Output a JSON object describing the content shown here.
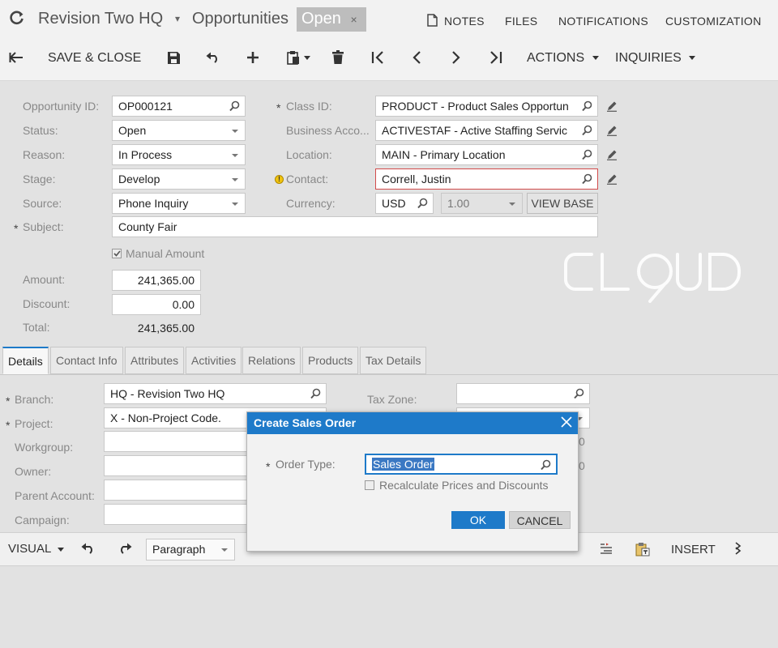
{
  "header": {
    "company": "Revision Two HQ",
    "separator_arrow": "▾",
    "screen": "Opportunities",
    "status": "Open",
    "status_close": "×",
    "links": [
      "NOTES",
      "FILES",
      "NOTIFICATIONS",
      "CUSTOMIZATION"
    ]
  },
  "toolbar": {
    "save_close": "SAVE & CLOSE",
    "actions": "ACTIONS",
    "inquiries": "INQUIRIES"
  },
  "form": {
    "opportunity_id": {
      "label": "Opportunity ID:",
      "value": "OP000121"
    },
    "status": {
      "label": "Status:",
      "value": "Open"
    },
    "reason": {
      "label": "Reason:",
      "value": "In Process"
    },
    "stage": {
      "label": "Stage:",
      "value": "Develop"
    },
    "source": {
      "label": "Source:",
      "value": "Phone Inquiry"
    },
    "subject": {
      "label": "Subject:",
      "value": "County Fair"
    },
    "manual_amount": {
      "label": "Manual Amount",
      "checked": true
    },
    "amount": {
      "label": "Amount:",
      "value": "241,365.00"
    },
    "discount": {
      "label": "Discount:",
      "value": "0.00"
    },
    "total": {
      "label": "Total:",
      "value": "241,365.00"
    },
    "class_id": {
      "label": "Class ID:",
      "value": "PRODUCT - Product Sales Opportun"
    },
    "business_account": {
      "label": "Business Acco...",
      "value": "ACTIVESTAF - Active Staffing Servic"
    },
    "location": {
      "label": "Location:",
      "value": "MAIN - Primary Location"
    },
    "contact": {
      "label": "Contact:",
      "value": "Correll, Justin"
    },
    "currency": {
      "label": "Currency:",
      "value": "USD",
      "rate": "1.00",
      "view_base": "VIEW BASE"
    },
    "required_mark": "*",
    "warning_mark": "!"
  },
  "watermark": "CLOUD",
  "tabs": [
    "Details",
    "Contact Info",
    "Attributes",
    "Activities",
    "Relations",
    "Products",
    "Tax Details"
  ],
  "details": {
    "branch": {
      "label": "Branch:",
      "value": "HQ - Revision Two HQ"
    },
    "project": {
      "label": "Project:",
      "value": "X - Non-Project Code."
    },
    "workgroup": {
      "label": "Workgroup:",
      "value": ""
    },
    "owner": {
      "label": "Owner:",
      "value": ""
    },
    "parent_account": {
      "label": "Parent Account:",
      "value": ""
    },
    "campaign": {
      "label": "Campaign:",
      "value": ""
    },
    "tax_zone": {
      "label": "Tax Zone:",
      "value": ""
    },
    "right_edge_values": [
      "0",
      "0"
    ]
  },
  "editor": {
    "visual": "VISUAL",
    "paragraph": "Paragraph",
    "insert": "INSERT"
  },
  "dialog": {
    "title": "Create Sales Order",
    "order_type_label": "Order Type:",
    "order_type_value": "Sales Order",
    "recalc_label": "Recalculate Prices and Discounts",
    "recalc_checked": false,
    "ok": "OK",
    "cancel": "CANCEL"
  },
  "colors": {
    "accent": "#1e7ac9",
    "error_border": "#d24b4b",
    "warning": "#f1c40f"
  }
}
